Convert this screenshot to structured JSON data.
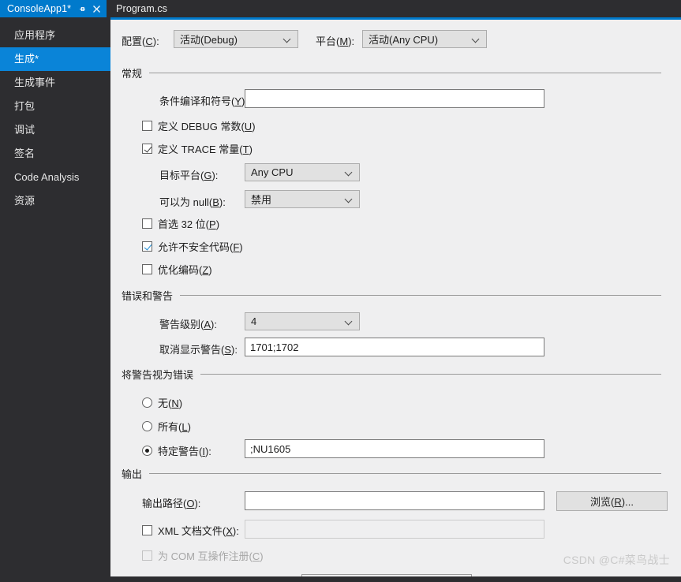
{
  "tabs": [
    {
      "label": "ConsoleApp1*",
      "active": true,
      "icons": [
        "pin-icon",
        "close-icon"
      ]
    },
    {
      "label": "Program.cs",
      "active": false,
      "icons": []
    }
  ],
  "sidebar": {
    "items": [
      {
        "label": "应用程序",
        "selected": false
      },
      {
        "label": "生成*",
        "selected": true
      },
      {
        "label": "生成事件",
        "selected": false
      },
      {
        "label": "打包",
        "selected": false
      },
      {
        "label": "调试",
        "selected": false
      },
      {
        "label": "签名",
        "selected": false
      },
      {
        "label": "Code Analysis",
        "selected": false
      },
      {
        "label": "资源",
        "selected": false
      }
    ]
  },
  "toolbar": {
    "configuration_label": "配置(C):",
    "configuration_value": "活动(Debug)",
    "platform_label": "平台(M):",
    "platform_value": "活动(Any CPU)"
  },
  "general": {
    "group_title": "常规",
    "conditional_symbols_label": "条件编译和符号(Y):",
    "conditional_symbols_value": "",
    "define_debug_label": "定义 DEBUG 常数(U)",
    "define_debug_checked": false,
    "define_trace_label": "定义 TRACE 常量(T)",
    "define_trace_checked": true,
    "target_platform_label": "目标平台(G):",
    "target_platform_value": "Any CPU",
    "nullable_label": "可以为 null(B):",
    "nullable_value": "禁用",
    "prefer32_label": "首选 32 位(P)",
    "prefer32_checked": false,
    "unsafe_label": "允许不安全代码(F)",
    "unsafe_checked": true,
    "optimize_label": "优化编码(Z)",
    "optimize_checked": false
  },
  "errors": {
    "group_title": "错误和警告",
    "warning_level_label": "警告级别(A):",
    "warning_level_value": "4",
    "suppress_warnings_label": "取消显示警告(S):",
    "suppress_warnings_value": "1701;1702"
  },
  "treat_warnings": {
    "group_title": "将警告视为错误",
    "none_label": "无(N)",
    "none_selected": false,
    "all_label": "所有(L)",
    "all_selected": false,
    "specific_label": "特定警告(I):",
    "specific_selected": true,
    "specific_value": ";NU1605"
  },
  "output": {
    "group_title": "输出",
    "output_path_label": "输出路径(O):",
    "output_path_value": "",
    "browse_label": "浏览(R)...",
    "xml_doc_label": "XML 文档文件(X):",
    "xml_doc_checked": false,
    "xml_doc_value": "",
    "com_interop_label": "为 COM 互操作注册(C)",
    "com_interop_checked": false,
    "com_interop_disabled": true
  },
  "watermark": "CSDN @C#菜鸟战士",
  "colors": {
    "accent": "#007acc",
    "nav_selected": "#0a84d8",
    "chrome": "#2d2d30",
    "pane": "#efeff0"
  }
}
